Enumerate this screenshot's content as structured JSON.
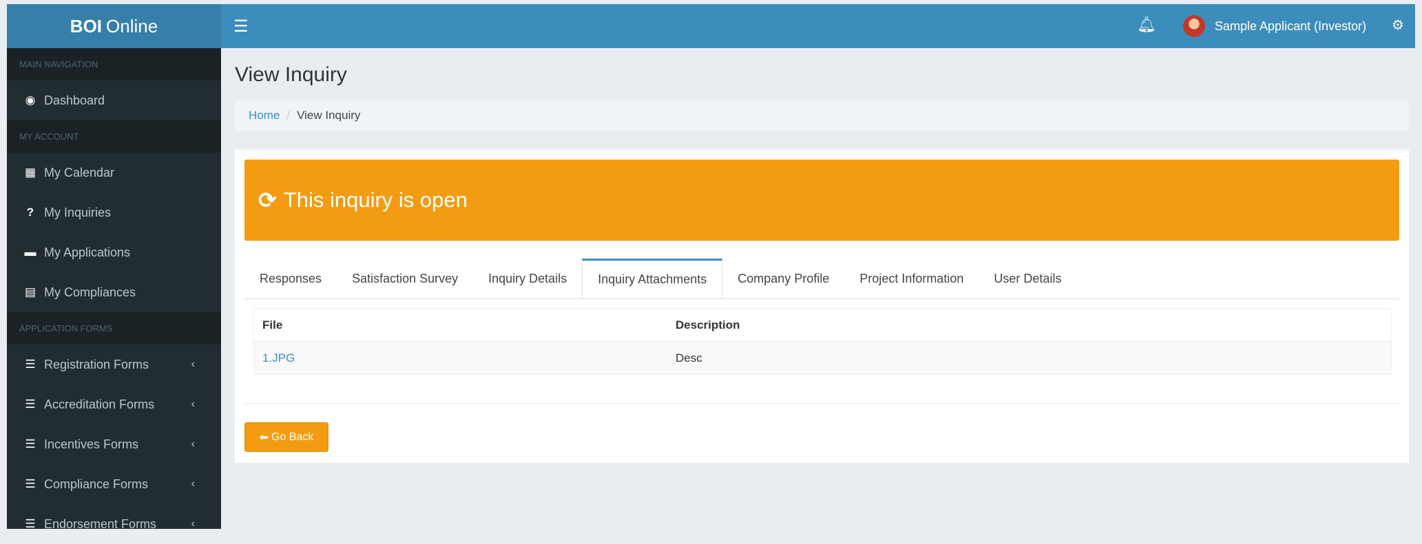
{
  "brand": {
    "bold": "BOI",
    "rest": "Online"
  },
  "topbar": {
    "user_name": "Sample Applicant (Investor)"
  },
  "sidebar": {
    "header_main": "MAIN NAVIGATION",
    "dashboard": "Dashboard",
    "header_account": "MY ACCOUNT",
    "account_items": [
      "My Calendar",
      "My Inquiries",
      "My Applications",
      "My Compliances"
    ],
    "header_forms": "APPLICATION FORMS",
    "form_items": [
      "Registration Forms",
      "Accreditation Forms",
      "Incentives Forms",
      "Compliance Forms",
      "Endorsement Forms"
    ]
  },
  "page": {
    "title": "View Inquiry"
  },
  "breadcrumb": {
    "home": "Home",
    "current": "View Inquiry"
  },
  "alert": {
    "text": "This inquiry is open"
  },
  "tabs": [
    "Responses",
    "Satisfaction Survey",
    "Inquiry Details",
    "Inquiry Attachments",
    "Company Profile",
    "Project Information",
    "User Details"
  ],
  "active_tab": "Inquiry Attachments",
  "table": {
    "headers": [
      "File",
      "Description"
    ],
    "rows": [
      [
        "1.JPG",
        "Desc"
      ]
    ]
  },
  "buttons": {
    "go_back": "Go Back"
  },
  "colors": {
    "accent": "#3c8dbc",
    "warning": "#f39c12",
    "sidebar": "#222d32"
  }
}
